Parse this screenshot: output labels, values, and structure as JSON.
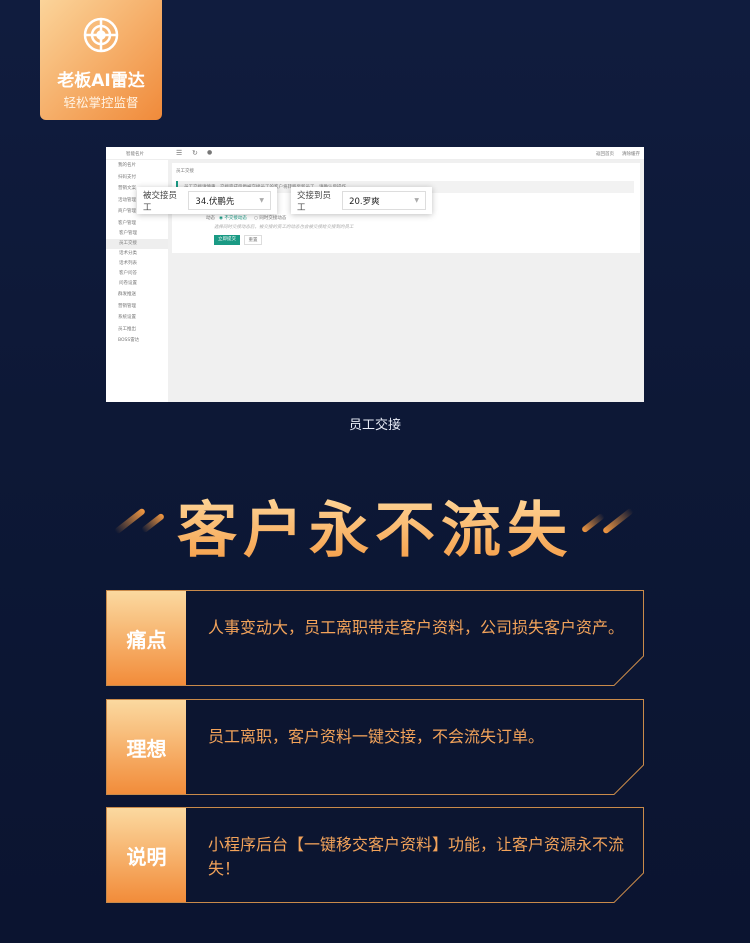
{
  "badge": {
    "title": "老板AI雷达",
    "subtitle": "轻松掌控监督",
    "icon": "radar-target-icon"
  },
  "screenshot": {
    "brand": "智能名片",
    "top_links": [
      "返回首页",
      "清除缓存"
    ],
    "sidebar": [
      {
        "label": "我的名片"
      },
      {
        "label": "扫码支付"
      },
      {
        "label": "营销文案"
      },
      {
        "label": "活动管理"
      },
      {
        "label": "商户管理"
      },
      {
        "label": "客户管理"
      }
    ],
    "sidebar_sub": [
      "客户管理",
      "员工交接",
      "话术分类",
      "话术列表",
      "客户问答",
      "问卷设置"
    ],
    "sidebar_after": [
      "群发推送",
      "营销管理",
      "系统设置",
      "员工推出",
      "BOSS雷达"
    ],
    "panel_title": "员工交接",
    "notice": "员工交接请慎重，交接完成后原被交接员工的客户将转移至新员工，请确认后操作",
    "dynamic_label": "动态",
    "radio1": "不交接动态",
    "radio2": "同时交接动态",
    "hint": "选择同时交接动态后，被交接的员工的动态也会被交接给交接到的员工",
    "submit": "立即提交",
    "reset": "重置",
    "from_label": "被交接员工",
    "from_value": "34.伏鹏先",
    "to_label": "交接到员工",
    "to_value": "20.罗爽"
  },
  "caption": "员工交接",
  "headline": "客户永不流失",
  "cards": [
    {
      "label": "痛点",
      "text": "人事变动大，员工离职带走客户资料，公司损失客户资产。"
    },
    {
      "label": "理想",
      "text": "员工离职，客户资料一键交接，不会流失订单。"
    },
    {
      "label": "说明",
      "text": "小程序后台【一键移交客户资料】功能，让客户资源永不流失！"
    }
  ],
  "colors": {
    "accent": "#f59a42",
    "background": "#0d1836",
    "action": "#1a9a84"
  }
}
